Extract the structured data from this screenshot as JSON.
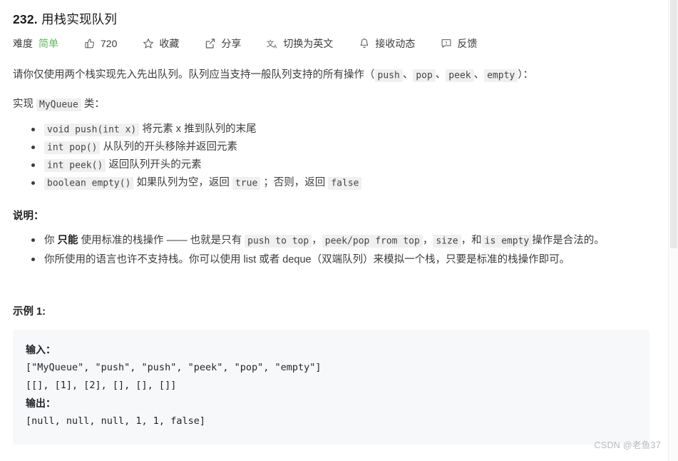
{
  "problem": {
    "number": "232.",
    "title": "用栈实现队列",
    "full_title": "232. 用栈实现队列"
  },
  "meta": {
    "difficulty_label": "难度",
    "difficulty_value": "简单",
    "difficulty_color": "#5eb95e",
    "likes_count": "720",
    "likes_icon": "thumbs-up-icon",
    "favorite_label": "收藏",
    "favorite_icon": "star-icon",
    "share_label": "分享",
    "share_icon": "share-icon",
    "translate_label": "切换为英文",
    "translate_icon": "translate-icon",
    "subscribe_label": "接收动态",
    "subscribe_icon": "bell-icon",
    "feedback_label": "反馈",
    "feedback_icon": "feedback-icon"
  },
  "description": {
    "intro_a": "请你仅使用两个栈实现先入先出队列。队列应当支持一般队列支持的所有操作（",
    "ops": [
      "push",
      "pop",
      "peek",
      "empty"
    ],
    "op_sep": "、",
    "intro_b": "）：",
    "impl_a": "实现",
    "impl_class": "MyQueue",
    "impl_b": "类：",
    "methods": [
      {
        "code": "void push(int x)",
        "text": "将元素 x 推到队列的末尾"
      },
      {
        "code": "int pop()",
        "text": "从队列的开头移除并返回元素"
      },
      {
        "code": "int peek()",
        "text": "返回队列开头的元素"
      },
      {
        "code": "boolean empty()",
        "text_a": "如果队列为空，返回",
        "code_b": "true",
        "text_b": "；否则，返回",
        "code_c": "false"
      }
    ]
  },
  "notes": {
    "heading": "说明：",
    "items": [
      {
        "a": "你",
        "bold": "只能",
        "b": "使用标准的栈操作 —— 也就是只有",
        "code1": "push to top",
        "sep1": "，",
        "code2": "peek/pop from top",
        "sep2": "，",
        "code3": "size",
        "sep3": "，和",
        "code4": "is empty",
        "c": "操作是合法的。"
      },
      {
        "plain": "你所使用的语言也许不支持栈。你可以使用 list 或者 deque（双端队列）来模拟一个栈，只要是标准的栈操作即可。"
      }
    ]
  },
  "example": {
    "heading": "示例 1:",
    "input_label": "输入：",
    "input_lines": [
      "[\"MyQueue\", \"push\", \"push\", \"peek\", \"pop\", \"empty\"]",
      "[[], [1], [2], [], [], []]"
    ],
    "output_label": "输出：",
    "output_lines": [
      "[null, null, null, 1, 1, false]"
    ]
  },
  "watermark": {
    "text": "CSDN @老鱼37"
  }
}
